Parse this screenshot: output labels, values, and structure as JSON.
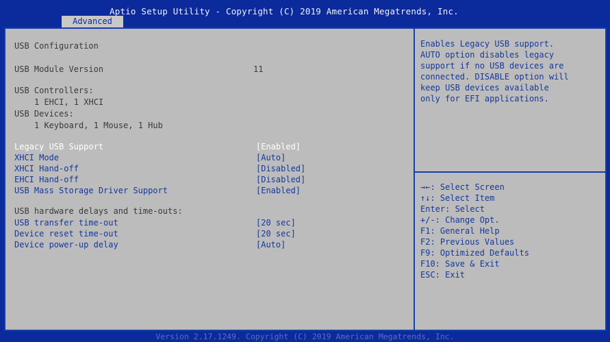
{
  "header": {
    "title": "Aptio Setup Utility - Copyright (C) 2019 American Megatrends, Inc.",
    "tab": "Advanced"
  },
  "left": {
    "usb_configuration": "USB Configuration",
    "module_version_label": "USB Module Version",
    "module_version_value": "11",
    "controllers_label": "USB Controllers:",
    "controllers_value": "1 EHCI, 1 XHCI",
    "devices_label": "USB Devices:",
    "devices_value": "1 Keyboard, 1 Mouse, 1 Hub",
    "settings": [
      {
        "label": "Legacy USB Support",
        "value": "[Enabled]"
      },
      {
        "label": "XHCI Mode",
        "value": "[Auto]"
      },
      {
        "label": "XHCI Hand-off",
        "value": "[Disabled]"
      },
      {
        "label": "EHCI Hand-off",
        "value": "[Disabled]"
      },
      {
        "label": "USB Mass Storage Driver Support",
        "value": "[Enabled]"
      }
    ],
    "delays_header": "USB hardware delays and time-outs:",
    "delays": [
      {
        "label": "USB transfer time-out",
        "value": "[20 sec]"
      },
      {
        "label": "Device reset time-out",
        "value": "[20 sec]"
      },
      {
        "label": "Device power-up delay",
        "value": "[Auto]"
      }
    ]
  },
  "right": {
    "help_text": "Enables Legacy USB support.\nAUTO option disables legacy\nsupport if no USB devices are\nconnected. DISABLE option will\nkeep USB devices available\nonly for EFI applications.",
    "keys": [
      "→←: Select Screen",
      "↑↓: Select Item",
      "Enter: Select",
      "+/-: Change Opt.",
      "F1: General Help",
      "F2: Previous Values",
      "F9: Optimized Defaults",
      "F10: Save & Exit",
      "ESC: Exit"
    ]
  },
  "footer": {
    "text": "Version 2.17.1249. Copyright (C) 2019 American Megatrends, Inc."
  },
  "colors": {
    "background": "#0b2a9c",
    "panel": "#bcbcbc",
    "text_blue": "#16399c",
    "text_gray": "#3a3a3a",
    "selected": "#ffffff"
  }
}
